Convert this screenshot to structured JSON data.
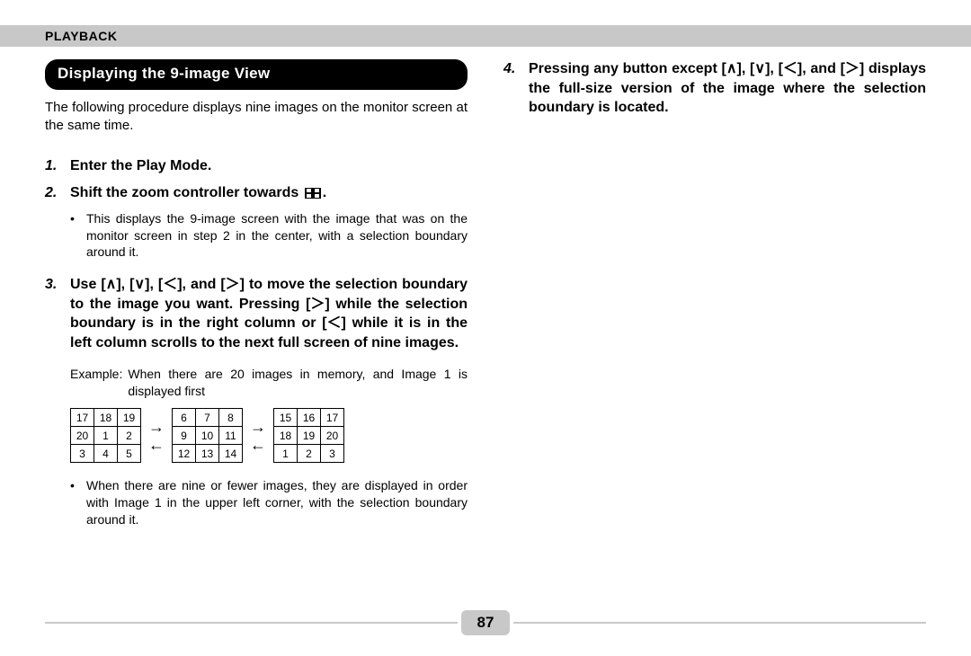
{
  "header": {
    "section": "PLAYBACK"
  },
  "left": {
    "title": "Displaying the 9-image View",
    "intro": "The following procedure displays nine images on the monitor screen at the same time.",
    "step1": {
      "num": "1.",
      "text": "Enter the Play Mode."
    },
    "step2": {
      "num": "2.",
      "text_before": "Shift the zoom controller towards ",
      "text_after": ".",
      "sub_bullet": "•",
      "sub": "This displays the 9-image screen with the image that was on the monitor screen in step 2 in the center, with a selection boundary around it."
    },
    "step3": {
      "num": "3.",
      "text": "Use [∧], [∨], [＜], and [＞] to move the selection boundary to the image you want. Pressing [＞] while the selection boundary is in the right column or [＜] while it is in the left column scrolls to the next full screen of nine images.",
      "example_prefix": "Example:",
      "example": "When there are 20 images in memory, and Image 1 is displayed first",
      "grids": [
        [
          [
            "17",
            "18",
            "19"
          ],
          [
            "20",
            "1",
            "2"
          ],
          [
            "3",
            "4",
            "5"
          ]
        ],
        [
          [
            "6",
            "7",
            "8"
          ],
          [
            "9",
            "10",
            "11"
          ],
          [
            "12",
            "13",
            "14"
          ]
        ],
        [
          [
            "15",
            "16",
            "17"
          ],
          [
            "18",
            "19",
            "20"
          ],
          [
            "1",
            "2",
            "3"
          ]
        ]
      ],
      "arrow_right": "→",
      "arrow_left": "←",
      "note_bullet": "•",
      "note": "When there are nine or fewer images, they are displayed in order with Image 1 in the upper left corner, with the selection boundary around it."
    }
  },
  "right": {
    "step4": {
      "num": "4.",
      "text": "Pressing any button except [∧], [∨], [＜], and [＞] displays the full-size version of the image where the selection boundary is located."
    }
  },
  "page": "87"
}
